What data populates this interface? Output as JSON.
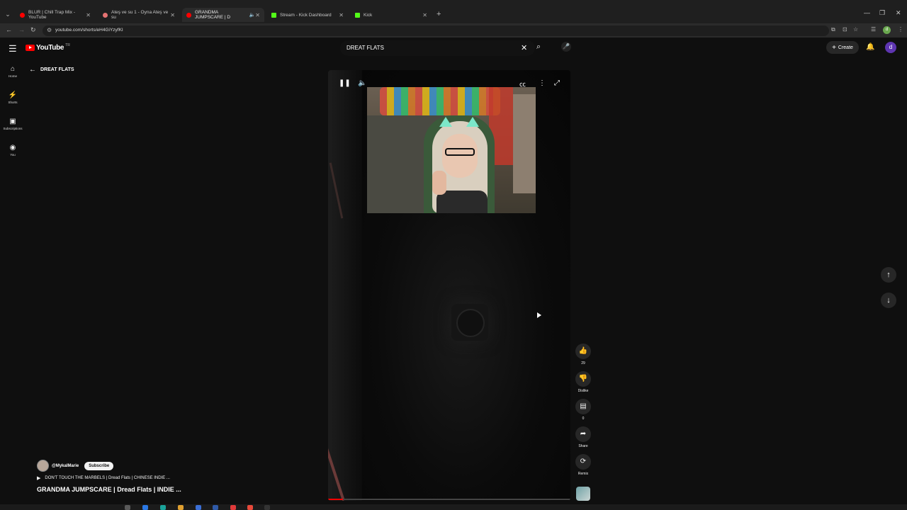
{
  "browser": {
    "tabs": [
      {
        "label": "BLUR | Chill Trap Mix - YouTube",
        "favicon_color": "#ff0000"
      },
      {
        "label": "Ateş ve su 1 - Oyna Ateş ve su",
        "favicon_color": "#e57373"
      },
      {
        "label": "GRANDMA JUMPSCARE | D",
        "favicon_color": "#ff0000"
      },
      {
        "label": "Stream - Kick Dashboard",
        "favicon_color": "#53fc18"
      },
      {
        "label": "Kick",
        "favicon_color": "#53fc18"
      }
    ],
    "url": "youtube.com/shorts/eH4GiYzyfKI",
    "profile_initial": "d"
  },
  "header": {
    "logo": "YouTube",
    "country": "TR",
    "search_value": "DREAT FLATS",
    "create_label": "Create",
    "avatar_initial": "d"
  },
  "guide": [
    {
      "icon": "⌂",
      "label": "Home"
    },
    {
      "icon": "⚡",
      "label": "Shorts"
    },
    {
      "icon": "▣",
      "label": "Subscriptions"
    },
    {
      "icon": "◉",
      "label": "You"
    }
  ],
  "breadcrumb": {
    "label": "DREAT FLATS"
  },
  "actions": [
    {
      "icon": "👍",
      "label": "29"
    },
    {
      "icon": "👎",
      "label": "Dislike"
    },
    {
      "icon": "▤",
      "label": "0"
    },
    {
      "icon": "➦",
      "label": "Share"
    },
    {
      "icon": "⟳",
      "label": "Remix"
    }
  ],
  "video": {
    "channel": "@MykalMarie",
    "subscribe_label": "Subscribe",
    "playlist": "DON'T TOUCH THE MARBELS | Dread Flats | CHINESE INDIE ...",
    "title": "GRANDMA JUMPSCARE | Dread Flats | INDIE ...",
    "progress": 0.06
  },
  "colors": {
    "accent": "#ff0000",
    "background": "#0f0f0f"
  }
}
